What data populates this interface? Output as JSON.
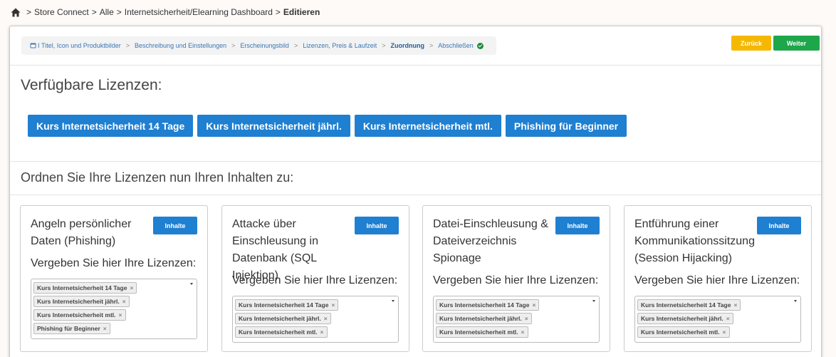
{
  "breadcrumb": {
    "items": [
      "Store Connect",
      "Alle",
      "Internetsicherheit/Elearning Dashboard"
    ],
    "current": "Editieren",
    "separator": ">"
  },
  "wizard": {
    "steps": [
      {
        "label": "Titel, Icon und Produktbilder",
        "state": "done"
      },
      {
        "label": "Beschreibung und Einstellungen",
        "state": "done"
      },
      {
        "label": "Erscheinungsbild",
        "state": "done"
      },
      {
        "label": "Lizenzen, Preis & Laufzeit",
        "state": "done"
      },
      {
        "label": "Zuordnung",
        "state": "active"
      },
      {
        "label": "Abschließen",
        "state": "pending"
      }
    ],
    "back_label": "Zurück",
    "next_label": "Weiter"
  },
  "available": {
    "heading": "Verfügbare Lizenzen:",
    "licenses": [
      "Kurs Internetsicherheit 14 Tage",
      "Kurs Internetsicherheit jährl.",
      "Kurs Internetsicherheit mtl.",
      "Phishing für Beginner"
    ]
  },
  "assign": {
    "heading": "Ordnen Sie Ihre Lizenzen nun Ihren Inhalten zu:",
    "content_button_label": "Inhalte",
    "sub_label": "Vergeben Sie hier Ihre Lizenzen:",
    "cards": [
      {
        "title": "Angeln persönlicher Daten (Phishing)",
        "tags": [
          "Kurs Internetsicherheit 14 Tage",
          "Kurs Internetsicherheit jährl.",
          "Kurs Internetsicherheit mtl.",
          "Phishing für Beginner"
        ]
      },
      {
        "title": "Attacke über Einschleusung in Datenbank (SQL Injektion)",
        "tags": [
          "Kurs Internetsicherheit 14 Tage",
          "Kurs Internetsicherheit jährl.",
          "Kurs Internetsicherheit mtl."
        ]
      },
      {
        "title": "Datei-Einschleusung & Dateiverzeichnis Spionage",
        "tags": [
          "Kurs Internetsicherheit 14 Tage",
          "Kurs Internetsicherheit jährl.",
          "Kurs Internetsicherheit mtl."
        ]
      },
      {
        "title": "Entführung einer Kommunikationssitzung (Session Hijacking)",
        "tags": [
          "Kurs Internetsicherheit 14 Tage",
          "Kurs Internetsicherheit jährl.",
          "Kurs Internetsicherheit mtl."
        ]
      }
    ]
  },
  "icons": {
    "home": "home-icon",
    "step": "window-icon",
    "done": "check-circle-icon",
    "remove": "close-icon",
    "dropdown": "caret-down-icon"
  },
  "colors": {
    "primary": "#1f7fd1",
    "back": "#f5b800",
    "next": "#1ea64a",
    "done": "#1e8a3a"
  }
}
